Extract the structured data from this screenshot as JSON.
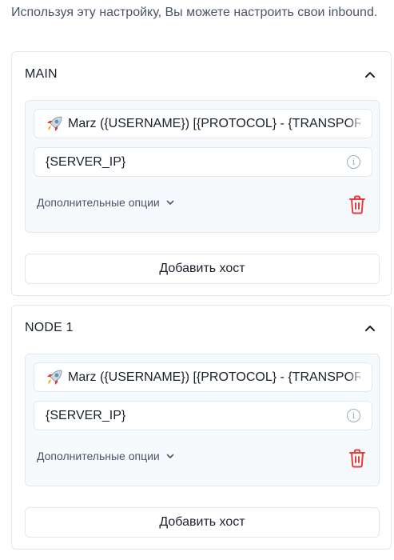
{
  "intro_text": "Используя эту настройку, Вы можете настроить свои inbound.",
  "sections": [
    {
      "title": "MAIN",
      "remark": "Marz ({USERNAME}) [{PROTOCOL} - {TRANSPORT}]",
      "address": "{SERVER_IP}",
      "options_label": "Дополнительные опции",
      "add_button": "Добавить хост"
    },
    {
      "title": "NODE 1",
      "remark": "Marz ({USERNAME}) [{PROTOCOL} - {TRANSPORT}]",
      "address": "{SERVER_IP}",
      "options_label": "Дополнительные опции",
      "add_button": "Добавить хост"
    }
  ],
  "colors": {
    "border": "#e2e8f0",
    "inner_bg": "#f7fafc",
    "danger": "#e53e3e",
    "muted": "#4a5568"
  },
  "icons": [
    "rocket-icon",
    "info-icon",
    "chevron-down-icon",
    "chevron-up-icon",
    "trash-icon"
  ]
}
